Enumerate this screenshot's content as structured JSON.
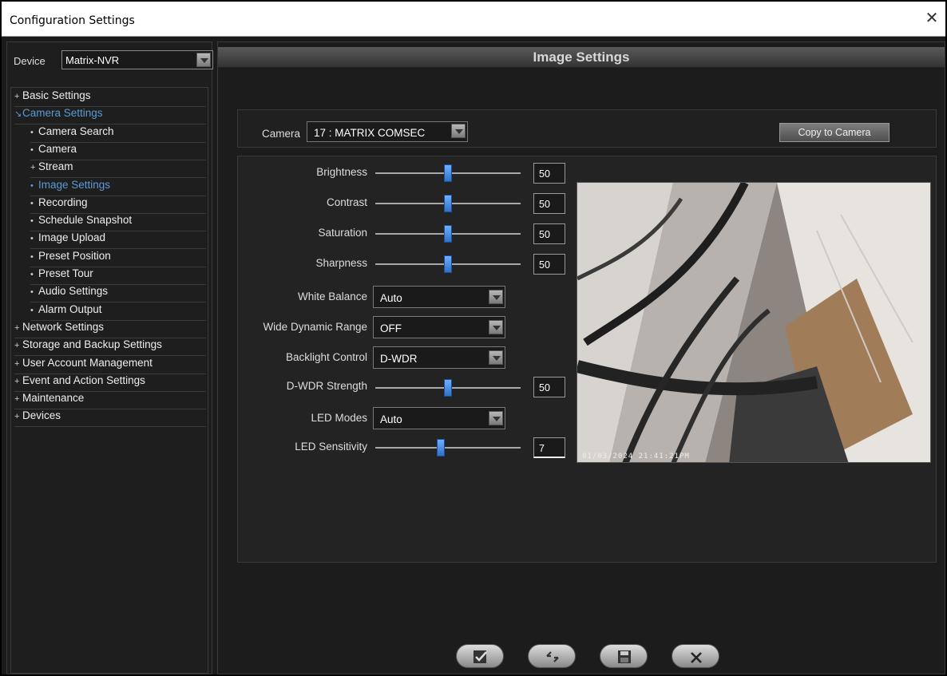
{
  "window": {
    "title": "Configuration Settings"
  },
  "device": {
    "label": "Device",
    "value": "Matrix-NVR"
  },
  "tree": [
    {
      "mark": "+",
      "label": "Basic Settings",
      "level": 0,
      "active": false
    },
    {
      "mark": "↘",
      "label": "Camera Settings",
      "level": 0,
      "active": true
    },
    {
      "mark": "•",
      "label": "Camera Search",
      "level": 1,
      "active": false
    },
    {
      "mark": "•",
      "label": "Camera",
      "level": 1,
      "active": false
    },
    {
      "mark": "+",
      "label": "Stream",
      "level": 1,
      "active": false
    },
    {
      "mark": "•",
      "label": "Image Settings",
      "level": 1,
      "active": true
    },
    {
      "mark": "•",
      "label": "Recording",
      "level": 1,
      "active": false
    },
    {
      "mark": "•",
      "label": "Schedule Snapshot",
      "level": 1,
      "active": false
    },
    {
      "mark": "•",
      "label": "Image Upload",
      "level": 1,
      "active": false
    },
    {
      "mark": "•",
      "label": "Preset Position",
      "level": 1,
      "active": false
    },
    {
      "mark": "•",
      "label": "Preset Tour",
      "level": 1,
      "active": false
    },
    {
      "mark": "•",
      "label": "Audio Settings",
      "level": 1,
      "active": false
    },
    {
      "mark": "•",
      "label": "Alarm Output",
      "level": 1,
      "active": false
    },
    {
      "mark": "+",
      "label": "Network Settings",
      "level": 0,
      "active": false
    },
    {
      "mark": "+",
      "label": "Storage and Backup Settings",
      "level": 0,
      "active": false
    },
    {
      "mark": "+",
      "label": "User Account Management",
      "level": 0,
      "active": false
    },
    {
      "mark": "+",
      "label": "Event and Action Settings",
      "level": 0,
      "active": false
    },
    {
      "mark": "+",
      "label": "Maintenance",
      "level": 0,
      "active": false
    },
    {
      "mark": "+",
      "label": "Devices",
      "level": 0,
      "active": false
    }
  ],
  "main": {
    "header": "Image Settings",
    "camera_label": "Camera",
    "camera_value": "17 : MATRIX COMSEC",
    "copy_button": "Copy to Camera"
  },
  "settings": {
    "brightness": {
      "label": "Brightness",
      "value": "50",
      "level": 0.5
    },
    "contrast": {
      "label": "Contrast",
      "value": "50",
      "level": 0.5
    },
    "saturation": {
      "label": "Saturation",
      "value": "50",
      "level": 0.5
    },
    "sharpness": {
      "label": "Sharpness",
      "value": "50",
      "level": 0.5
    },
    "white_balance": {
      "label": "White Balance",
      "value": "Auto"
    },
    "wdr": {
      "label": "Wide Dynamic Range",
      "value": "OFF"
    },
    "backlight": {
      "label": "Backlight Control",
      "value": "D-WDR"
    },
    "dwdr_strength": {
      "label": "D-WDR Strength",
      "value": "50",
      "level": 0.5
    },
    "led_modes": {
      "label": "LED Modes",
      "value": "Auto"
    },
    "led_sensitivity": {
      "label": "LED Sensitivity",
      "value": "7",
      "level": 0.45
    }
  },
  "preview": {
    "timestamp": "01/03/2024 21:41:21PM"
  },
  "buttons": [
    {
      "name": "apply-button",
      "icon": "check-icon"
    },
    {
      "name": "refresh-button",
      "icon": "refresh-icon"
    },
    {
      "name": "save-button",
      "icon": "save-icon"
    },
    {
      "name": "close-button",
      "icon": "close-icon"
    }
  ]
}
